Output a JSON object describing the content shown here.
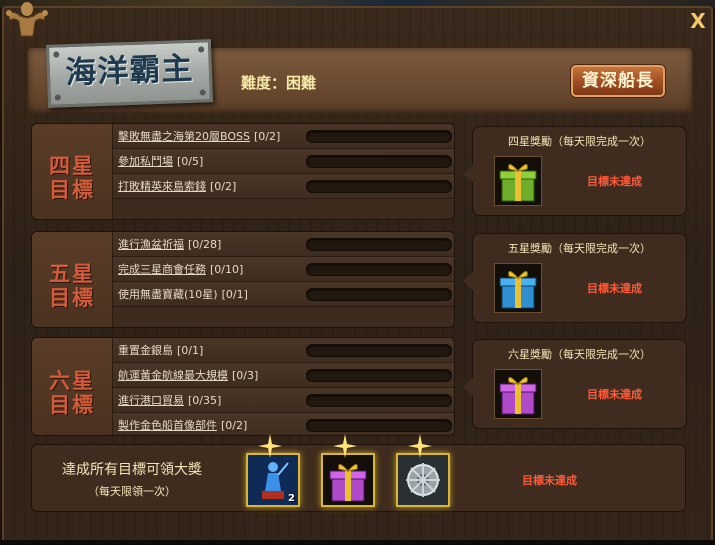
{
  "window": {
    "title": "海洋霸主",
    "close_label": "X",
    "difficulty": "難度：困難",
    "rank_button": "資深船長"
  },
  "sections": [
    {
      "label_line1": "四星",
      "label_line2": "目標",
      "tasks": [
        {
          "text": "擊敗無盡之海第20層BOSS",
          "count": "[0/2]"
        },
        {
          "text": "參加私鬥場",
          "count": "[0/5]"
        },
        {
          "text": "打敗精英來島索錢",
          "count": "[0/2]"
        }
      ],
      "reward_title": "四星獎勵（每天限完成一次）",
      "reward_status": "目標未達成",
      "reward_icon": "green-gift-box-icon"
    },
    {
      "label_line1": "五星",
      "label_line2": "目標",
      "tasks": [
        {
          "text": "進行漁盆祈福",
          "count": "[0/28]"
        },
        {
          "text": "完成三星商會任務",
          "count": "[0/10]"
        },
        {
          "text": "使用無盡寶藏(10星)",
          "count": "[0/1]"
        }
      ],
      "reward_title": "五星獎勵（每天限完成一次）",
      "reward_status": "目標未達成",
      "reward_icon": "blue-gift-box-icon"
    },
    {
      "label_line1": "六星",
      "label_line2": "目標",
      "tasks": [
        {
          "text": "重置金銀島",
          "count": "[0/1]"
        },
        {
          "text": "航運黃金航線最大規模",
          "count": "[0/3]"
        },
        {
          "text": "進行港口貿易",
          "count": "[0/35]"
        },
        {
          "text": "製作金色船首像部件",
          "count": "[0/2]"
        }
      ],
      "reward_title": "六星獎勵（每天限完成一次）",
      "reward_status": "目標未達成",
      "reward_icon": "purple-gift-box-icon"
    }
  ],
  "grand_prize": {
    "line1": "達成所有目標可領大獎",
    "line2": "（每天限領一次）",
    "status": "目標未達成",
    "items": [
      {
        "icon": "blue-figurehead-statue-icon",
        "quantity": "2"
      },
      {
        "icon": "purple-gift-box-icon",
        "quantity": ""
      },
      {
        "icon": "silver-ship-wheel-icon",
        "quantity": ""
      }
    ]
  },
  "colors": {
    "accent_gold": "#f2c868",
    "status_red": "#ff5a3a",
    "label_red": "#d25b3a",
    "wood_dark": "#3f2c1e"
  }
}
